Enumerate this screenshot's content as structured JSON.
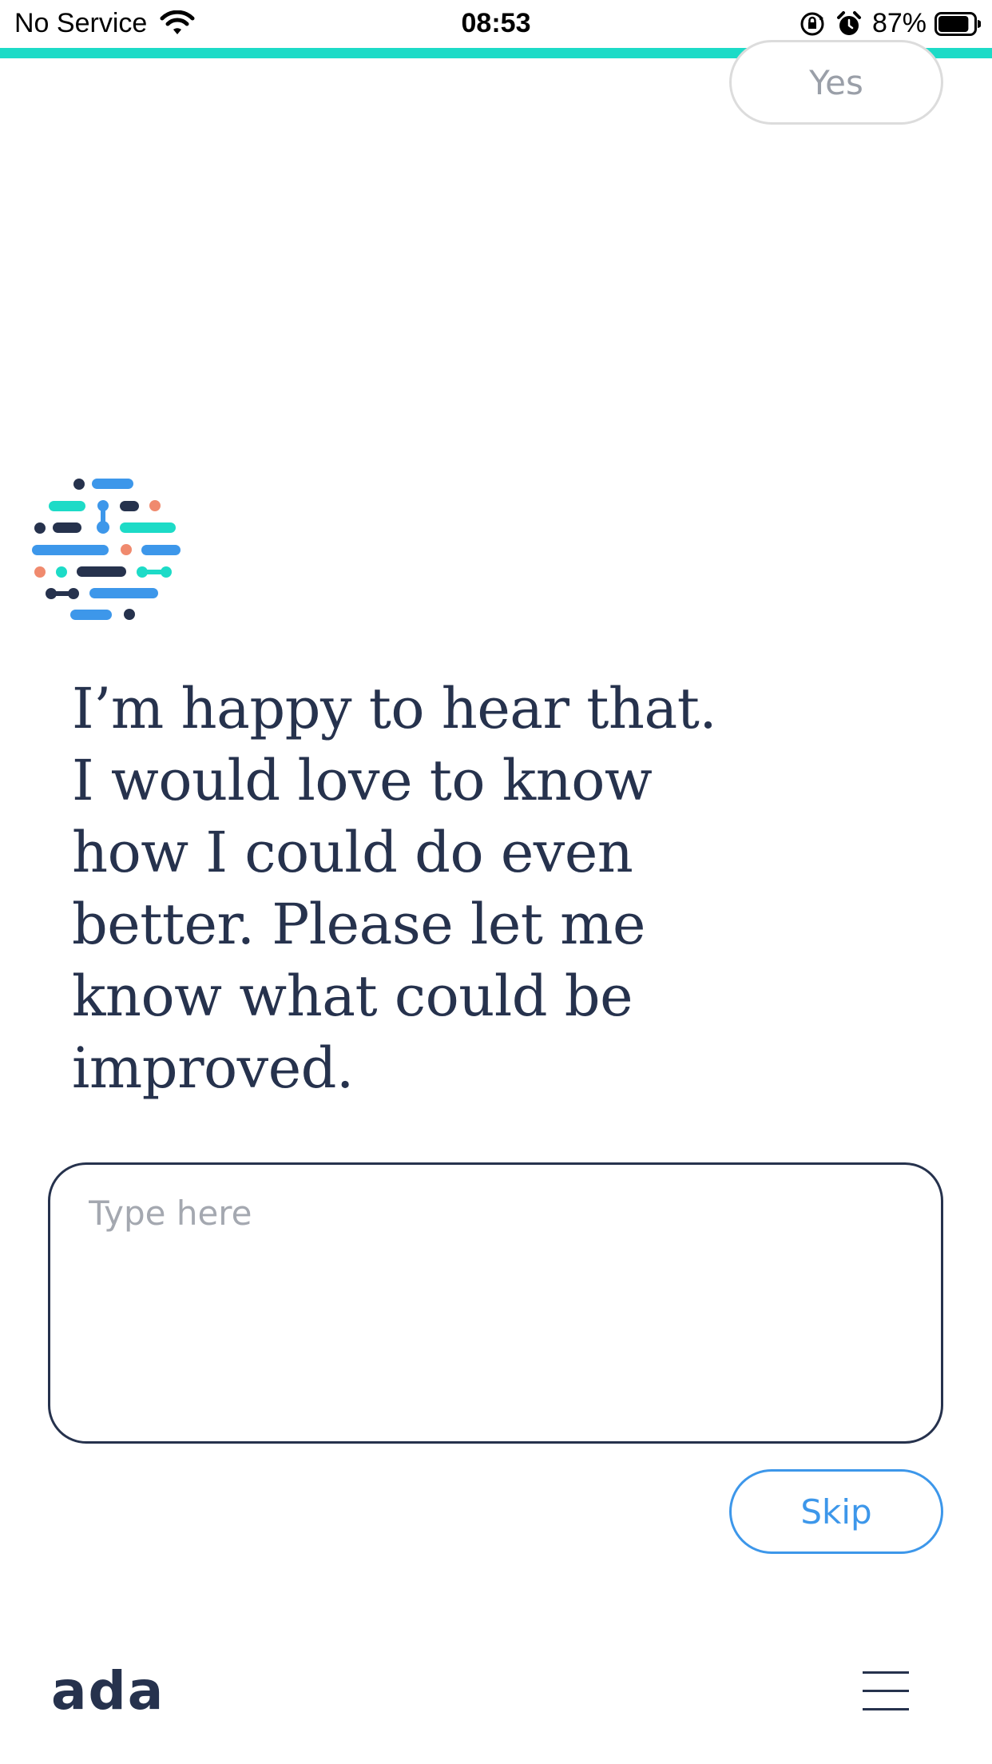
{
  "status_bar": {
    "carrier": "No Service",
    "time": "08:53",
    "battery_percent": "87%",
    "battery_level": 0.87,
    "icons": [
      "wifi-icon",
      "orientation-lock-icon",
      "alarm-icon",
      "battery-icon"
    ]
  },
  "colors": {
    "accent": "#1ddbc7",
    "text": "#26324d",
    "link_blue": "#3d97ea",
    "coral": "#f08a6e"
  },
  "previous_reply": {
    "label": "Yes"
  },
  "bot": {
    "icon": "ada-bot-logo-icon",
    "message": "I’m happy to hear that. I would love to know how I could do even better. Please let me know what could be improved."
  },
  "reply_input": {
    "value": "",
    "placeholder": "Type here"
  },
  "actions": {
    "skip_label": "Skip"
  },
  "footer": {
    "logo_text": "ada",
    "menu_icon": "hamburger-menu-icon"
  }
}
